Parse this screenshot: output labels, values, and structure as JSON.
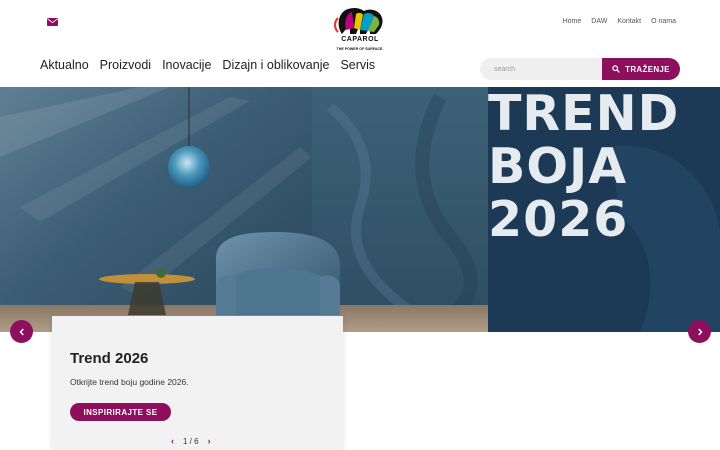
{
  "brand": {
    "name": "CAPAROL",
    "tagline": "THE POWER OF SURFACE."
  },
  "top_links": [
    "Home",
    "DAW",
    "Kontakt",
    "O nama"
  ],
  "main_nav": [
    "Aktualno",
    "Proizvodi",
    "Inovacije",
    "Dizajn i oblikovanje",
    "Servis"
  ],
  "search": {
    "placeholder": "search",
    "button_label": "TRAŽENJE"
  },
  "hero": {
    "lines": [
      "TREND",
      "BOJA",
      "2026"
    ]
  },
  "card": {
    "title": "Trend 2026",
    "text": "Otkrijte trend boju godine 2026.",
    "button_label": "INSPIRIRAJTE SE"
  },
  "pager": {
    "current": 1,
    "total": 6,
    "label": "1 / 6"
  },
  "colors": {
    "accent": "#8e0f5d",
    "hero_wall": "#2f4f66",
    "hero_panel": "#1c3a55"
  },
  "icons": [
    "mail-icon",
    "search-icon",
    "chevron-left-icon",
    "chevron-right-icon"
  ]
}
